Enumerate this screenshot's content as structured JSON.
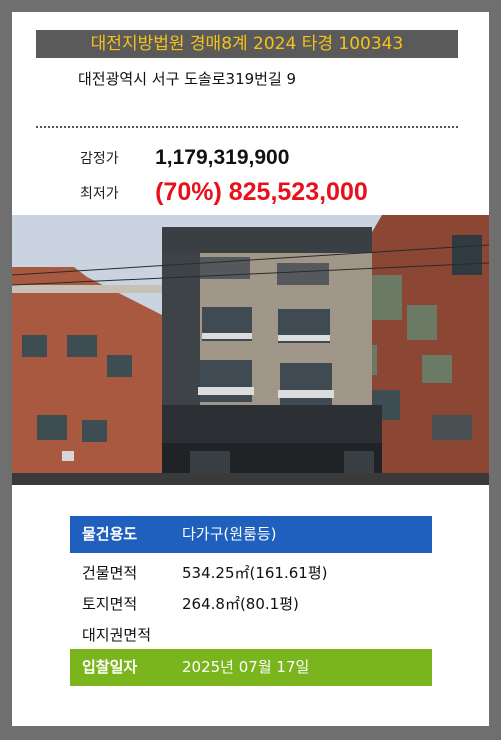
{
  "header": {
    "title": "대전지방법원 경매8계 2024 타경 100343",
    "address": "대전광역시 서구 도솔로319번길 9"
  },
  "prices": {
    "appraisal_label": "감정가",
    "appraisal_value": "1,179,319,900",
    "minimum_label": "최저가",
    "minimum_value": "(70%) 825,523,000"
  },
  "photo": {
    "subject": "building-photo"
  },
  "info": {
    "usage_label": "물건용도",
    "usage_value": "다가구(원룸등)",
    "building_area_label": "건물면적",
    "building_area_value": "534.25㎡(161.61평)",
    "land_area_label": "토지면적",
    "land_area_value": "264.8㎡(80.1평)",
    "land_right_label": "대지권면적",
    "land_right_value": "",
    "bid_date_label": "입찰일자",
    "bid_date_value": "2025년 07월 17일"
  },
  "colors": {
    "title_text": "#f5c21a",
    "title_bg": "#5a5a5a",
    "minimum_price": "#e8101b",
    "usage_bg": "#1f5fbd",
    "date_bg": "#7ab51d"
  }
}
